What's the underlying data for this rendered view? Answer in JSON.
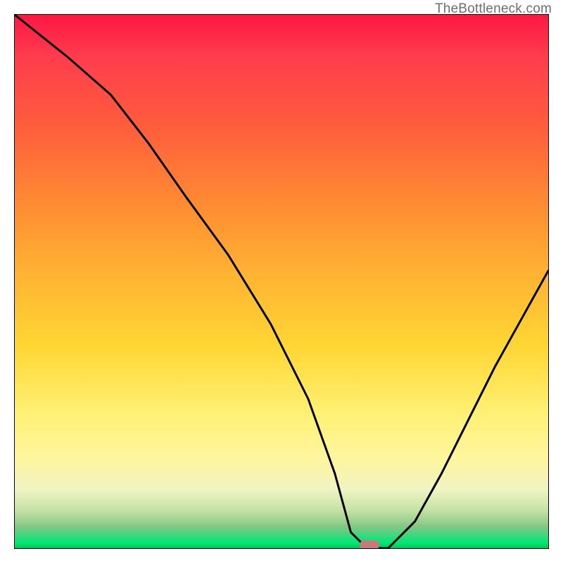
{
  "watermark": "TheBottleneck.com",
  "chart_data": {
    "type": "line",
    "x": [
      0.0,
      0.05,
      0.1,
      0.18,
      0.25,
      0.32,
      0.4,
      0.48,
      0.55,
      0.6,
      0.63,
      0.66,
      0.7,
      0.75,
      0.8,
      0.85,
      0.9,
      0.95,
      1.0
    ],
    "values": [
      1.0,
      0.96,
      0.92,
      0.85,
      0.76,
      0.66,
      0.55,
      0.42,
      0.28,
      0.14,
      0.03,
      0.0,
      0.0,
      0.05,
      0.14,
      0.24,
      0.34,
      0.43,
      0.52
    ],
    "title": "",
    "xlabel": "",
    "ylabel": "",
    "xlim": [
      0,
      1
    ],
    "ylim": [
      0,
      1
    ],
    "marker": {
      "x": 0.665,
      "y": 0.0,
      "color": "#c77a7a"
    },
    "gradient_stops": [
      {
        "pos": 0.0,
        "color": "#ff1744"
      },
      {
        "pos": 0.08,
        "color": "#ff3d4d"
      },
      {
        "pos": 0.2,
        "color": "#ff5a3d"
      },
      {
        "pos": 0.35,
        "color": "#ff8a33"
      },
      {
        "pos": 0.48,
        "color": "#ffb133"
      },
      {
        "pos": 0.62,
        "color": "#ffd633"
      },
      {
        "pos": 0.75,
        "color": "#fff176"
      },
      {
        "pos": 0.83,
        "color": "#fff59d"
      },
      {
        "pos": 0.89,
        "color": "#f0f4c3"
      },
      {
        "pos": 0.93,
        "color": "#c5e1a5"
      },
      {
        "pos": 0.96,
        "color": "#81c784"
      },
      {
        "pos": 0.99,
        "color": "#00e676"
      },
      {
        "pos": 1.0,
        "color": "#00c853"
      }
    ]
  }
}
